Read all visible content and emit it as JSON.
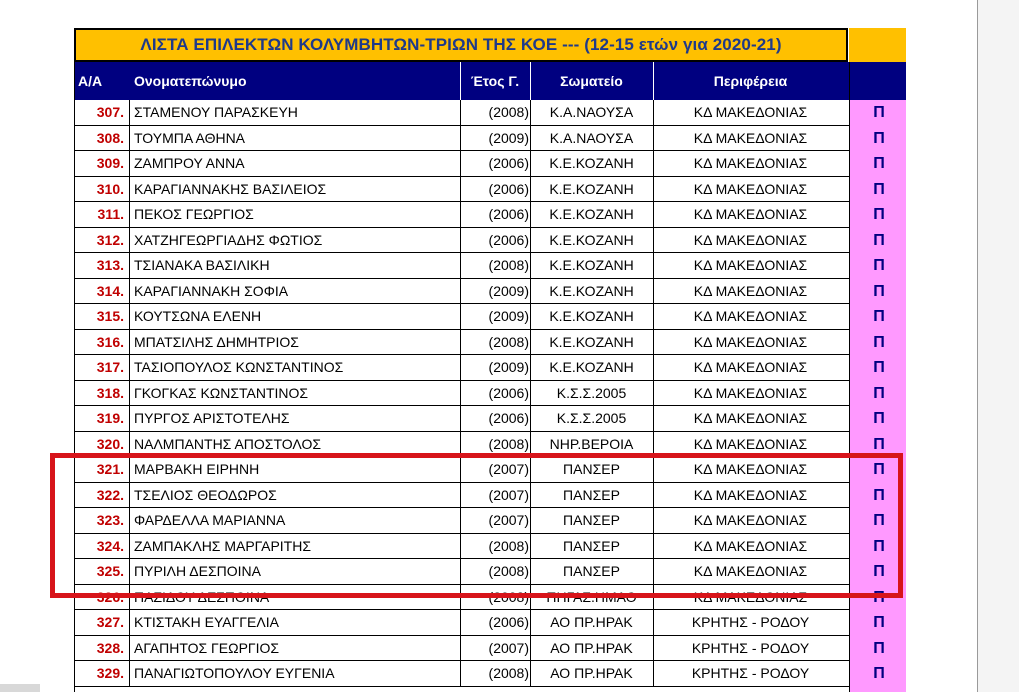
{
  "title": "ΛΙΣΤΑ ΕΠΙΛΕΚΤΩΝ ΚΟΛΥΜΒΗΤΩΝ-ΤΡΙΩΝ ΤΗΣ ΚΟΕ --- (12-15 ετών για 2020-21)",
  "headers": {
    "aa": "Α/Α",
    "name": "Ονοματεπώνυμο",
    "year": "Έτος Γ.",
    "club": "Σωματείο",
    "region": "Περιφέρεια"
  },
  "marker": "Π",
  "colors": {
    "title_bg": "#ffc000",
    "title_text": "#1f3a8a",
    "header_bg": "#000080",
    "number_text": "#c00000",
    "marker_column_bg": "#ff99ff",
    "highlight_border": "#d7141a"
  },
  "rows": [
    {
      "num": "307.",
      "name": "ΣΤΑΜΕΝΟΥ ΠΑΡΑΣΚΕΥΗ",
      "year": "(2008)",
      "club": "Κ.Α.ΝΑΟΥΣΑ",
      "region": "ΚΔ ΜΑΚΕΔΟΝΙΑΣ"
    },
    {
      "num": "308.",
      "name": "ΤΟΥΜΠΑ ΑΘΗΝΑ",
      "year": "(2009)",
      "club": "Κ.Α.ΝΑΟΥΣΑ",
      "region": "ΚΔ ΜΑΚΕΔΟΝΙΑΣ"
    },
    {
      "num": "309.",
      "name": "ΖΑΜΠΡΟΥ ΑΝΝΑ",
      "year": "(2006)",
      "club": "Κ.Ε.ΚΟΖΑΝΗ",
      "region": "ΚΔ ΜΑΚΕΔΟΝΙΑΣ"
    },
    {
      "num": "310.",
      "name": "ΚΑΡΑΓΙΑΝΝΑΚΗΣ ΒΑΣΙΛΕΙΟΣ",
      "year": "(2006)",
      "club": "Κ.Ε.ΚΟΖΑΝΗ",
      "region": "ΚΔ ΜΑΚΕΔΟΝΙΑΣ"
    },
    {
      "num": "311.",
      "name": "ΠΕΚΟΣ ΓΕΩΡΓΙΟΣ",
      "year": "(2006)",
      "club": "Κ.Ε.ΚΟΖΑΝΗ",
      "region": "ΚΔ ΜΑΚΕΔΟΝΙΑΣ"
    },
    {
      "num": "312.",
      "name": "ΧΑΤΖΗΓΕΩΡΓΙΑΔΗΣ ΦΩΤΙΟΣ",
      "year": "(2006)",
      "club": "Κ.Ε.ΚΟΖΑΝΗ",
      "region": "ΚΔ ΜΑΚΕΔΟΝΙΑΣ"
    },
    {
      "num": "313.",
      "name": "ΤΣΙΑΝΑΚΑ ΒΑΣΙΛΙΚΗ",
      "year": "(2008)",
      "club": "Κ.Ε.ΚΟΖΑΝΗ",
      "region": "ΚΔ ΜΑΚΕΔΟΝΙΑΣ"
    },
    {
      "num": "314.",
      "name": "ΚΑΡΑΓΙΑΝΝΑΚΗ ΣΟΦΙΑ",
      "year": "(2009)",
      "club": "Κ.Ε.ΚΟΖΑΝΗ",
      "region": "ΚΔ ΜΑΚΕΔΟΝΙΑΣ"
    },
    {
      "num": "315.",
      "name": "ΚΟΥΤΣΩΝΑ ΕΛΕΝΗ",
      "year": "(2009)",
      "club": "Κ.Ε.ΚΟΖΑΝΗ",
      "region": "ΚΔ ΜΑΚΕΔΟΝΙΑΣ"
    },
    {
      "num": "316.",
      "name": "ΜΠΑΤΣΙΛΗΣ ΔΗΜΗΤΡΙΟΣ",
      "year": "(2008)",
      "club": "Κ.Ε.ΚΟΖΑΝΗ",
      "region": "ΚΔ ΜΑΚΕΔΟΝΙΑΣ"
    },
    {
      "num": "317.",
      "name": "ΤΑΣΙΟΠΟΥΛΟΣ ΚΩΝΣΤΑΝΤΙΝΟΣ",
      "year": "(2009)",
      "club": "Κ.Ε.ΚΟΖΑΝΗ",
      "region": "ΚΔ ΜΑΚΕΔΟΝΙΑΣ"
    },
    {
      "num": "318.",
      "name": "ΓΚΟΓΚΑΣ ΚΩΝΣΤΑΝΤΙΝΟΣ",
      "year": "(2006)",
      "club": "Κ.Σ.Σ.2005",
      "region": "ΚΔ ΜΑΚΕΔΟΝΙΑΣ"
    },
    {
      "num": "319.",
      "name": "ΠΥΡΓΟΣ ΑΡΙΣΤΟΤΕΛΗΣ",
      "year": "(2006)",
      "club": "Κ.Σ.Σ.2005",
      "region": "ΚΔ ΜΑΚΕΔΟΝΙΑΣ"
    },
    {
      "num": "320.",
      "name": "ΝΑΛΜΠΑΝΤΗΣ ΑΠΟΣΤΟΛΟΣ",
      "year": "(2008)",
      "club": "ΝΗΡ.ΒΕΡΟΙΑ",
      "region": "ΚΔ ΜΑΚΕΔΟΝΙΑΣ"
    },
    {
      "num": "321.",
      "name": "ΜΑΡΒΑΚΗ ΕΙΡΗΝΗ",
      "year": "(2007)",
      "club": "ΠΑΝΣΕΡ",
      "region": "ΚΔ ΜΑΚΕΔΟΝΙΑΣ"
    },
    {
      "num": "322.",
      "name": "ΤΣΕΛΙΟΣ ΘΕΟΔΩΡΟΣ",
      "year": "(2007)",
      "club": "ΠΑΝΣΕΡ",
      "region": "ΚΔ ΜΑΚΕΔΟΝΙΑΣ"
    },
    {
      "num": "323.",
      "name": "ΦΑΡΔΕΛΛΑ ΜΑΡΙΑΝΝΑ",
      "year": "(2007)",
      "club": "ΠΑΝΣΕΡ",
      "region": "ΚΔ ΜΑΚΕΔΟΝΙΑΣ"
    },
    {
      "num": "324.",
      "name": "ΖΑΜΠΑΚΛΗΣ ΜΑΡΓΑΡΙΤΗΣ",
      "year": "(2008)",
      "club": "ΠΑΝΣΕΡ",
      "region": "ΚΔ ΜΑΚΕΔΟΝΙΑΣ"
    },
    {
      "num": "325.",
      "name": "ΠΥΡΙΛΗ ΔΕΣΠΟΙΝΑ",
      "year": "(2008)",
      "club": "ΠΑΝΣΕΡ",
      "region": "ΚΔ ΜΑΚΕΔΟΝΙΑΣ"
    },
    {
      "num": "326.",
      "name": "ΠΑΖΙΔΟΥ ΔΕΣΠΟΙΝΑ",
      "year": "(2008)",
      "club": "ΠΗΓΑΣ.ΗΜΑΘ",
      "region": "ΚΔ ΜΑΚΕΔΟΝΙΑΣ"
    },
    {
      "num": "327.",
      "name": "ΚΤΙΣΤΑΚΗ ΕΥΑΓΓΕΛΙΑ",
      "year": "(2006)",
      "club": "ΑΟ ΠΡ.ΗΡΑΚ",
      "region": "ΚΡΗΤΗΣ - ΡΟΔΟΥ"
    },
    {
      "num": "328.",
      "name": "ΑΓΑΠΗΤΟΣ ΓΕΩΡΓΙΟΣ",
      "year": "(2007)",
      "club": "ΑΟ ΠΡ.ΗΡΑΚ",
      "region": "ΚΡΗΤΗΣ - ΡΟΔΟΥ"
    },
    {
      "num": "329.",
      "name": "ΠΑΝΑΓΙΩΤΟΠΟΥΛΟΥ ΕΥΓΕΝΙΑ",
      "year": "(2008)",
      "club": "ΑΟ ΠΡ.ΗΡΑΚ",
      "region": "ΚΡΗΤΗΣ - ΡΟΔΟΥ"
    }
  ]
}
